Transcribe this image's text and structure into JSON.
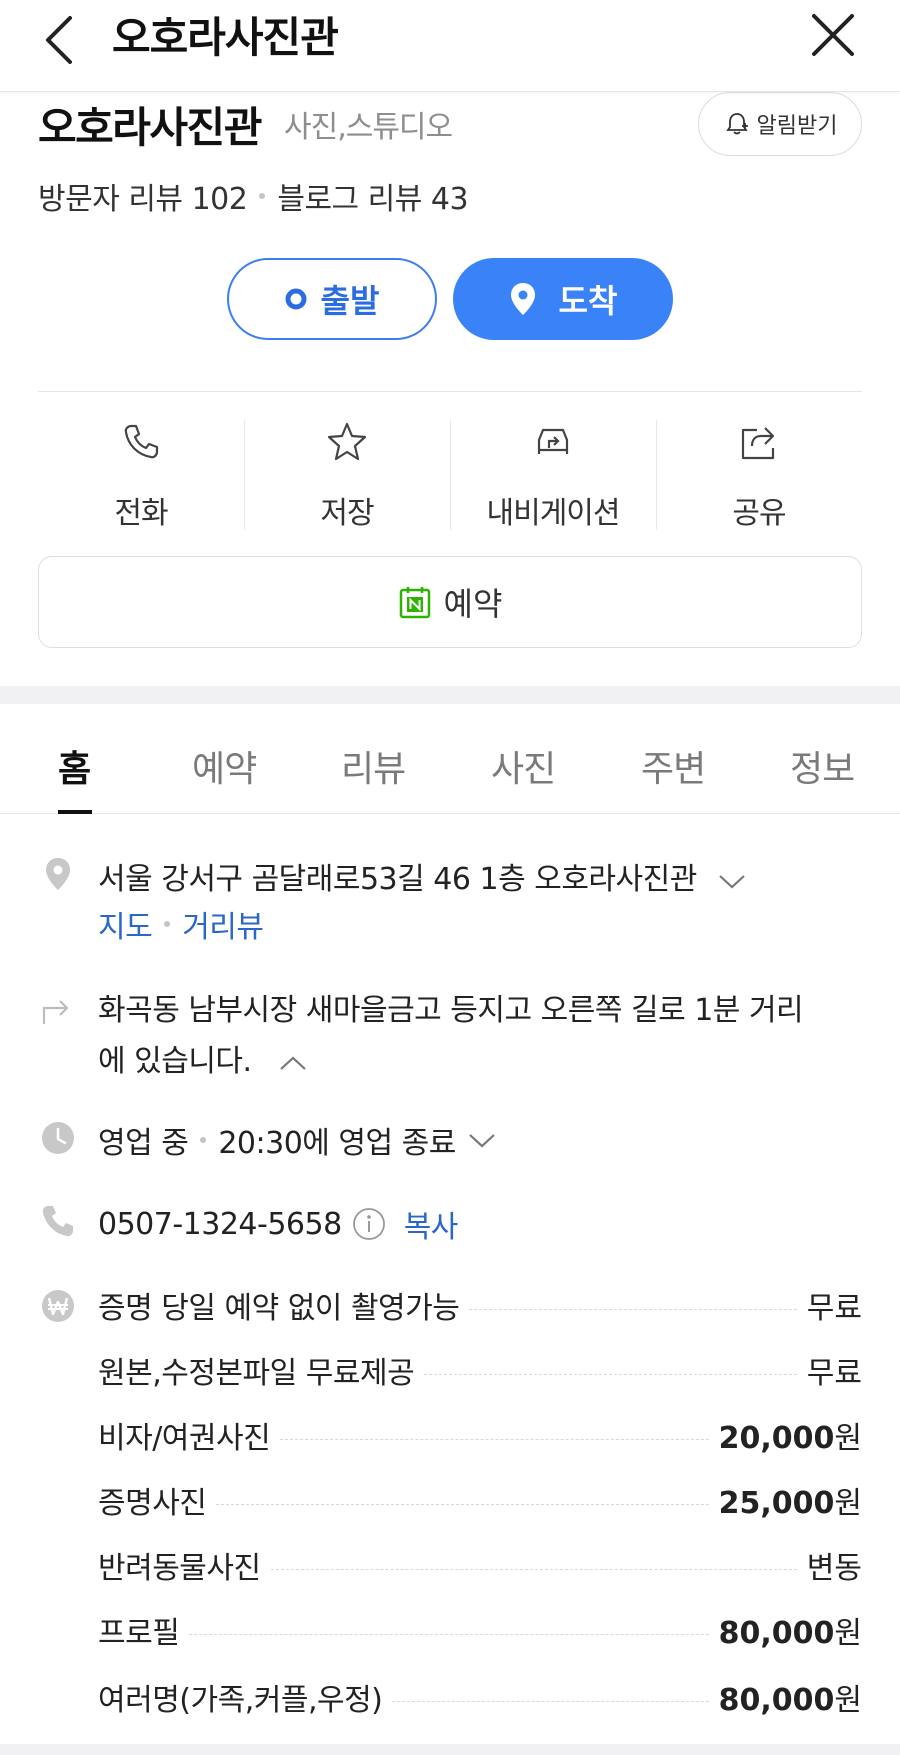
{
  "topbar": {
    "title": "오호라사진관"
  },
  "header": {
    "name": "오호라사진관",
    "category": "사진,스튜디오",
    "notify_label": "알림받기",
    "visitor_reviews": "방문자 리뷰 102",
    "blog_reviews": "블로그 리뷰 43"
  },
  "route": {
    "depart_label": "출발",
    "arrive_label": "도착"
  },
  "actions": [
    {
      "label": "전화",
      "icon": "phone-icon"
    },
    {
      "label": "저장",
      "icon": "star-icon"
    },
    {
      "label": "내비게이션",
      "icon": "car-navigation-icon"
    },
    {
      "label": "공유",
      "icon": "share-icon"
    }
  ],
  "reserve": {
    "label": "예약",
    "icon": "naver-calendar-icon"
  },
  "tabs": [
    "홈",
    "예약",
    "리뷰",
    "사진",
    "주변",
    "정보"
  ],
  "active_tab": "홈",
  "address": {
    "text": "서울 강서구 곰달래로53길 46 1층 오호라사진관",
    "map_link": "지도",
    "street_view_link": "거리뷰"
  },
  "directions": {
    "line1": "화곡동 남부시장 새마을금고 등지고 오른쪽 길로 1분 거리",
    "line2": "에 있습니다."
  },
  "hours": {
    "status": "영업 중",
    "detail": "20:30에 영업 종료"
  },
  "phone": {
    "number": "0507-1324-5658",
    "copy_label": "복사"
  },
  "prices": [
    {
      "name": "증명 당일 예약 없이 촬영가능",
      "value": "무료",
      "amount": "",
      "unit": ""
    },
    {
      "name": "원본,수정본파일 무료제공",
      "value": "무료",
      "amount": "",
      "unit": ""
    },
    {
      "name": "비자/여권사진",
      "value": "",
      "amount": "20,000",
      "unit": "원"
    },
    {
      "name": "증명사진",
      "value": "",
      "amount": "25,000",
      "unit": "원"
    },
    {
      "name": "반려동물사진",
      "value": "변동",
      "amount": "",
      "unit": ""
    },
    {
      "name": "프로필",
      "value": "",
      "amount": "80,000",
      "unit": "원"
    },
    {
      "name": "여러명(가족,커플,우정)",
      "value": "",
      "amount": "80,000",
      "unit": "원"
    }
  ],
  "colors": {
    "accent": "#3a82f7",
    "link": "#2a67c9",
    "naver_green": "#2db400"
  }
}
